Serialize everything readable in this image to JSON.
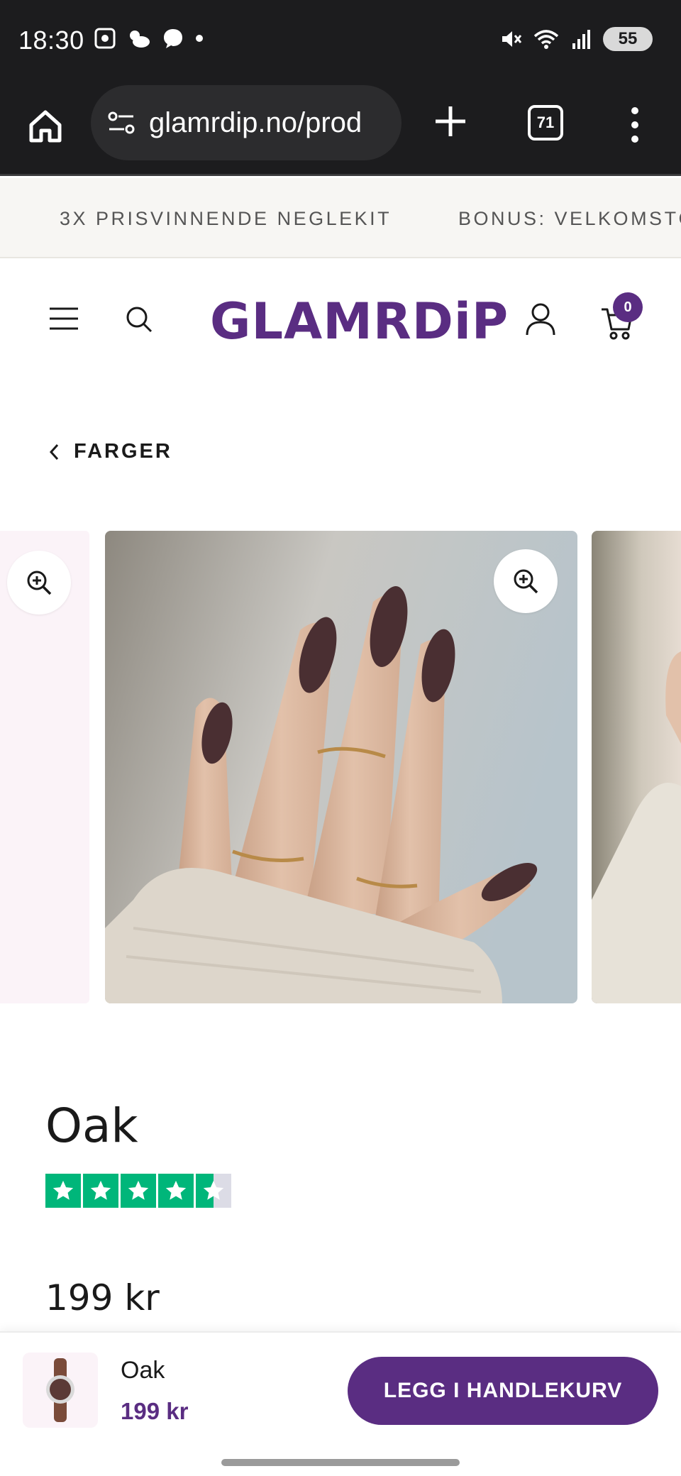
{
  "status_bar": {
    "time": "18:30",
    "battery": "55",
    "icons": [
      "screenshot-icon",
      "weather-icon",
      "chat-icon",
      "dot-icon",
      "mute-icon",
      "wifi-icon",
      "signal-icon"
    ]
  },
  "browser": {
    "url": "glamrdip.no/prod",
    "tab_count": "71"
  },
  "announcement": {
    "items": [
      "3X PRISVINNENDE NEGLEKIT",
      "BONUS: VELKOMSTG"
    ]
  },
  "header": {
    "logo": "GLAMRDiP",
    "cart_count": "0"
  },
  "breadcrumb": {
    "back_label": "FARGER"
  },
  "product": {
    "title": "Oak",
    "rating_stars": 4.5,
    "price": "199 kr",
    "nail_color": "#4a2f32"
  },
  "sticky_bar": {
    "name": "Oak",
    "price": "199 kr",
    "button_label": "LEGG I HANDLEKURV"
  },
  "colors": {
    "brand": "#5a2d82",
    "star_green": "#00b67a"
  }
}
